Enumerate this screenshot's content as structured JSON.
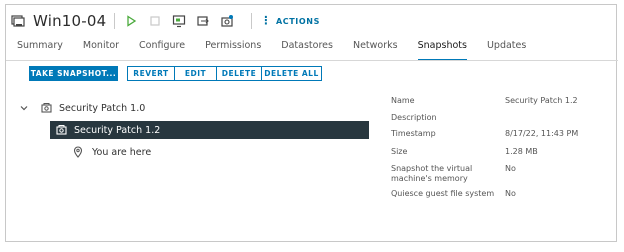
{
  "header": {
    "title": "Win10-04",
    "actions_label": "ACTIONS",
    "accent": "#0079b8"
  },
  "tabs": [
    {
      "label": "Summary"
    },
    {
      "label": "Monitor"
    },
    {
      "label": "Configure"
    },
    {
      "label": "Permissions"
    },
    {
      "label": "Datastores"
    },
    {
      "label": "Networks"
    },
    {
      "label": "Snapshots",
      "active": true
    },
    {
      "label": "Updates"
    }
  ],
  "toolbar": {
    "take_snapshot": "TAKE SNAPSHOT...",
    "revert": "REVERT",
    "edit": "EDIT",
    "delete": "DELETE",
    "delete_all": "DELETE ALL"
  },
  "tree": {
    "root": "Security Patch 1.0",
    "child": "Security Patch 1.2",
    "here": "You are here"
  },
  "details": {
    "name_label": "Name",
    "name_value": "Security Patch 1.2",
    "description_label": "Description",
    "description_value": "",
    "timestamp_label": "Timestamp",
    "timestamp_value": "8/17/22, 11:43 PM",
    "size_label": "Size",
    "size_value": "1.28 MB",
    "memory_label": "Snapshot the virtual machine's memory",
    "memory_value": "No",
    "quiesce_label": "Quiesce guest file system",
    "quiesce_value": "No"
  },
  "icons": [
    "vm-icon",
    "power-on-icon",
    "power-off-icon",
    "console-icon",
    "migrate-icon",
    "snapshot-icon",
    "chevron-down-icon",
    "location-pin-icon"
  ]
}
